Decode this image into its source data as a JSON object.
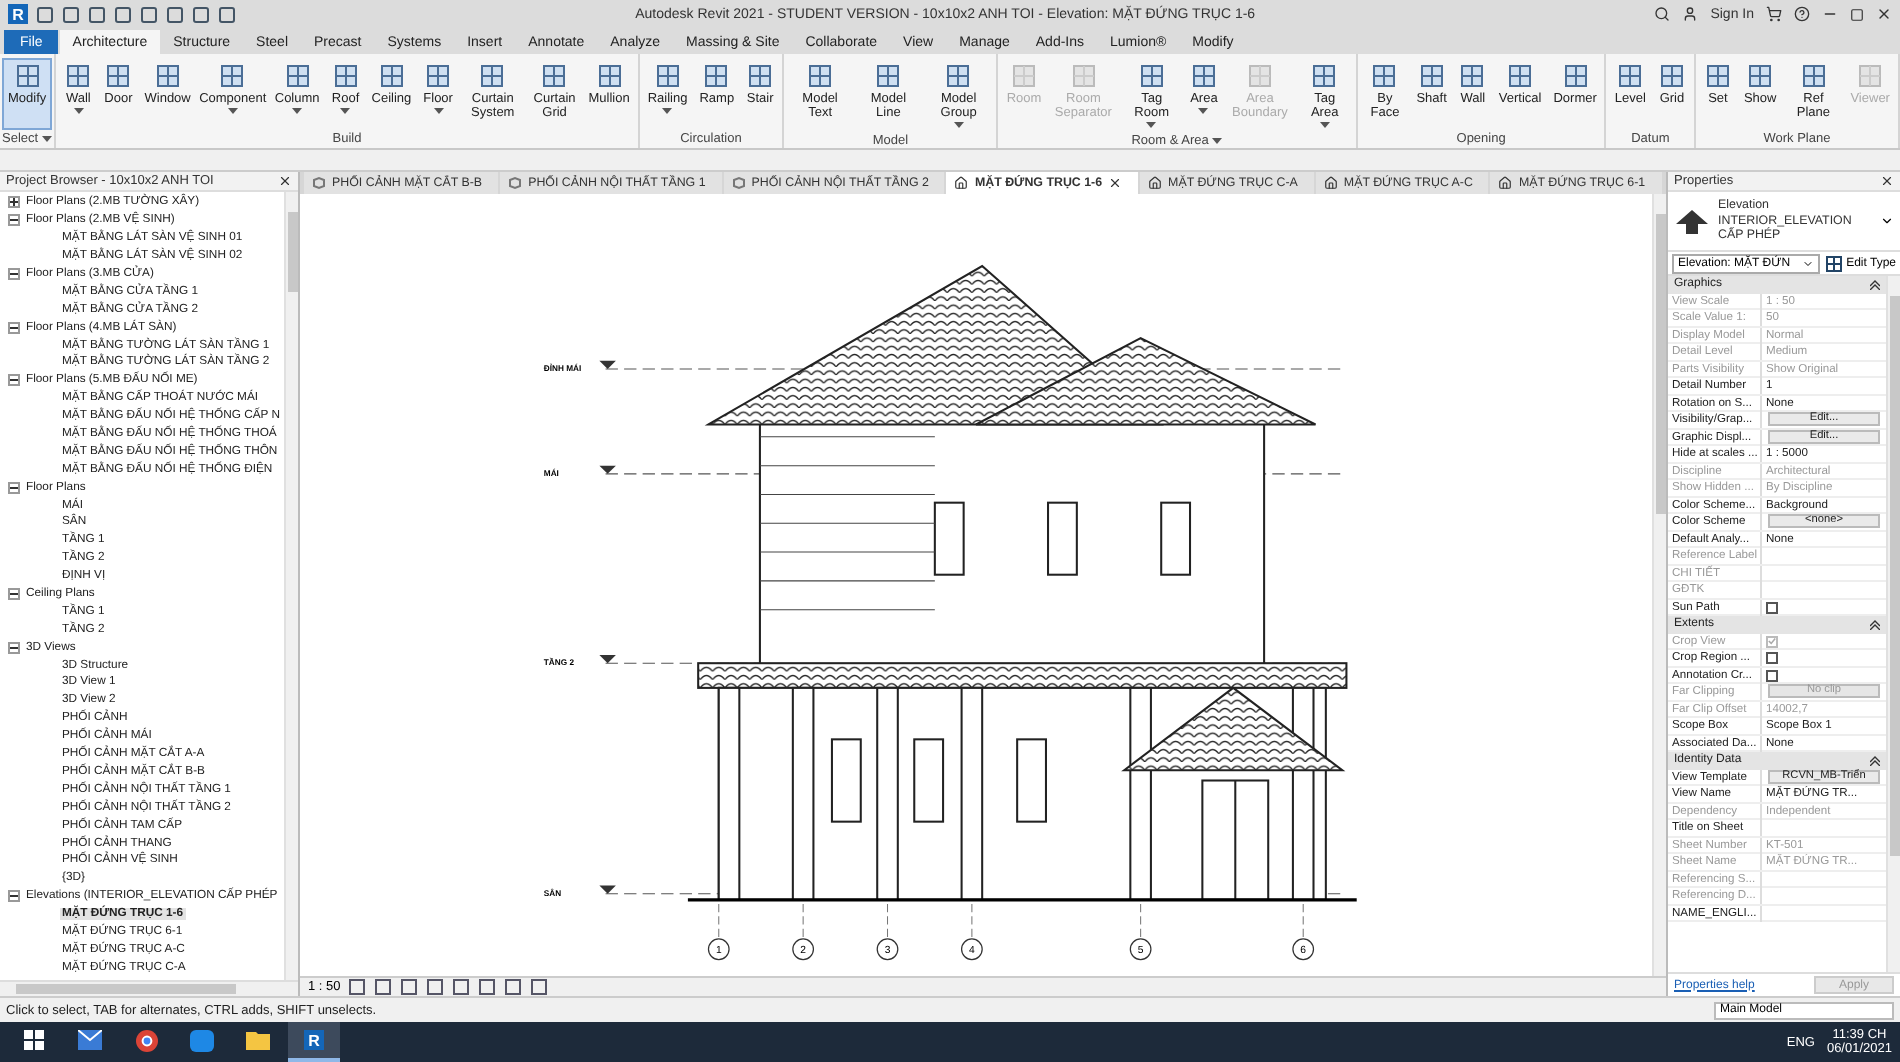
{
  "title_bar": {
    "logo_letter": "R",
    "title": "Autodesk Revit 2021 - STUDENT VERSION - 10x10x2 ANH TOI - Elevation: MẶT ĐỨNG TRỤC 1-6",
    "sign_in": "Sign In"
  },
  "file_tab": {
    "label": "File"
  },
  "ribbon_tabs": [
    {
      "label": "Architecture",
      "selected": true
    },
    {
      "label": "Structure",
      "selected": false
    },
    {
      "label": "Steel",
      "selected": false
    },
    {
      "label": "Precast",
      "selected": false
    },
    {
      "label": "Systems",
      "selected": false
    },
    {
      "label": "Insert",
      "selected": false
    },
    {
      "label": "Annotate",
      "selected": false
    },
    {
      "label": "Analyze",
      "selected": false
    },
    {
      "label": "Massing & Site",
      "selected": false
    },
    {
      "label": "Collaborate",
      "selected": false
    },
    {
      "label": "View",
      "selected": false
    },
    {
      "label": "Manage",
      "selected": false
    },
    {
      "label": "Add-Ins",
      "selected": false
    },
    {
      "label": "Lumion®",
      "selected": false
    },
    {
      "label": "Modify",
      "selected": false
    }
  ],
  "ribbon_panels": [
    {
      "label": "Select",
      "dropdown": true,
      "tools": [
        {
          "label": "Modify",
          "selected": true,
          "disabled": false
        }
      ]
    },
    {
      "label": "Build",
      "tools": [
        {
          "label": "Wall",
          "dropdown": true,
          "disabled": false
        },
        {
          "label": "Door",
          "disabled": false
        },
        {
          "label": "Window",
          "disabled": false
        },
        {
          "label": "Component",
          "dropdown": true,
          "disabled": false
        },
        {
          "label": "Column",
          "dropdown": true,
          "disabled": false
        },
        {
          "label": "Roof",
          "dropdown": true,
          "disabled": false
        },
        {
          "label": "Ceiling",
          "disabled": false
        },
        {
          "label": "Floor",
          "dropdown": true,
          "disabled": false
        },
        {
          "label": "Curtain System",
          "disabled": false
        },
        {
          "label": "Curtain Grid",
          "disabled": false
        },
        {
          "label": "Mullion",
          "disabled": false
        }
      ]
    },
    {
      "label": "Circulation",
      "tools": [
        {
          "label": "Railing",
          "dropdown": true,
          "disabled": false
        },
        {
          "label": "Ramp",
          "disabled": false
        },
        {
          "label": "Stair",
          "disabled": false
        }
      ]
    },
    {
      "label": "Model",
      "tools": [
        {
          "label": "Model Text",
          "disabled": false
        },
        {
          "label": "Model Line",
          "disabled": false
        },
        {
          "label": "Model Group",
          "dropdown": true,
          "disabled": false
        }
      ]
    },
    {
      "label": "Room & Area",
      "dropdown": true,
      "tools": [
        {
          "label": "Room",
          "disabled": true
        },
        {
          "label": "Room Separator",
          "disabled": true
        },
        {
          "label": "Tag Room",
          "dropdown": true,
          "disabled": false
        },
        {
          "label": "Area",
          "dropdown": true,
          "disabled": false
        },
        {
          "label": "Area Boundary",
          "disabled": true
        },
        {
          "label": "Tag Area",
          "dropdown": true,
          "disabled": false
        }
      ]
    },
    {
      "label": "Opening",
      "tools": [
        {
          "label": "By Face",
          "disabled": false
        },
        {
          "label": "Shaft",
          "disabled": false
        },
        {
          "label": "Wall",
          "disabled": false
        },
        {
          "label": "Vertical",
          "disabled": false
        },
        {
          "label": "Dormer",
          "disabled": false
        }
      ]
    },
    {
      "label": "Datum",
      "tools": [
        {
          "label": "Level",
          "disabled": false
        },
        {
          "label": "Grid",
          "disabled": false
        }
      ]
    },
    {
      "label": "Work Plane",
      "tools": [
        {
          "label": "Set",
          "disabled": false
        },
        {
          "label": "Show",
          "disabled": false
        },
        {
          "label": "Ref Plane",
          "disabled": false
        },
        {
          "label": "Viewer",
          "disabled": true
        }
      ]
    }
  ],
  "project_browser": {
    "title": "Project Browser - 10x10x2 ANH TOI",
    "tree": [
      {
        "label": "Floor Plans (2.MB TƯỜNG XÂY)",
        "expanded": false
      },
      {
        "label": "Floor Plans (2.MB VỆ SINH)",
        "expanded": true,
        "children": [
          {
            "label": "MẶT BẰNG LÁT SÀN VỆ SINH 01"
          },
          {
            "label": "MẶT BẰNG LÁT SÀN VỆ SINH 02"
          }
        ]
      },
      {
        "label": "Floor Plans (3.MB CỬA)",
        "expanded": true,
        "children": [
          {
            "label": "MẶT BẰNG CỬA TẦNG 1"
          },
          {
            "label": "MẶT BẰNG CỬA TẦNG 2"
          }
        ]
      },
      {
        "label": "Floor Plans (4.MB LÁT SÀN)",
        "expanded": true,
        "children": [
          {
            "label": "MẶT BẰNG TƯỜNG LÁT SÀN TẦNG 1"
          },
          {
            "label": "MẶT BẰNG TƯỜNG LÁT SÀN TẦNG 2"
          }
        ]
      },
      {
        "label": "Floor Plans (5.MB ĐẤU NỐI ME)",
        "expanded": true,
        "children": [
          {
            "label": "MẶT BẰNG CẤP THOÁT NƯỚC MÁI"
          },
          {
            "label": "MẶT BẰNG ĐẤU NỐI HỆ THỐNG CẤP N"
          },
          {
            "label": "MẶT BẰNG ĐẤU NỐI HỆ THỐNG THOÁ"
          },
          {
            "label": "MẶT BẰNG ĐẤU NỐI HỆ THỐNG THÔN"
          },
          {
            "label": "MẶT BẰNG ĐẤU NỐI HỆ THỐNG ĐIỆN"
          }
        ]
      },
      {
        "label": "Floor Plans",
        "expanded": true,
        "children": [
          {
            "label": "MÁI"
          },
          {
            "label": "SÂN"
          },
          {
            "label": "TẦNG 1"
          },
          {
            "label": "TẦNG 2"
          },
          {
            "label": "ĐỊNH VỊ"
          }
        ]
      },
      {
        "label": "Ceiling Plans",
        "expanded": true,
        "children": [
          {
            "label": "TẦNG 1"
          },
          {
            "label": "TẦNG 2"
          }
        ]
      },
      {
        "label": "3D Views",
        "expanded": true,
        "children": [
          {
            "label": "3D Structure"
          },
          {
            "label": "3D View 1"
          },
          {
            "label": "3D View 2"
          },
          {
            "label": "PHỐI CẢNH"
          },
          {
            "label": "PHỐI CẢNH MÁI"
          },
          {
            "label": "PHỐI CẢNH MẶT CẮT A-A"
          },
          {
            "label": "PHỐI CẢNH MẶT CẮT B-B"
          },
          {
            "label": "PHỐI CẢNH NỘI THẤT TẦNG 1"
          },
          {
            "label": "PHỐI CẢNH NỘI THẤT TẦNG 2"
          },
          {
            "label": "PHỐI CẢNH TAM CẤP"
          },
          {
            "label": "PHỐI CẢNH THANG"
          },
          {
            "label": "PHỐI CẢNH VỆ SINH"
          },
          {
            "label": "{3D}"
          }
        ]
      },
      {
        "label": "Elevations (INTERIOR_ELEVATION CẤP PHÉP",
        "expanded": true,
        "children": [
          {
            "label": "MẶT ĐỨNG TRỤC 1-6",
            "selected": true
          },
          {
            "label": "MẶT ĐỨNG TRỤC 6-1",
            "selected": false
          },
          {
            "label": "MẶT ĐỨNG TRỤC A-C",
            "selected": false
          },
          {
            "label": "MẶT ĐỨNG TRỤC C-A",
            "selected": false
          }
        ]
      }
    ]
  },
  "view_tabs": [
    {
      "label": "PHỐI CẢNH MẶT CẮT B-B",
      "kind": "perspective",
      "selected": false
    },
    {
      "label": "PHỐI CẢNH NỘI THẤT TẦNG 1",
      "kind": "perspective",
      "selected": false
    },
    {
      "label": "PHỐI CẢNH NỘI THẤT TẦNG 2",
      "kind": "perspective",
      "selected": false
    },
    {
      "label": "MẶT ĐỨNG TRỤC 1-6",
      "kind": "elevation",
      "selected": true
    },
    {
      "label": "MẶT ĐỨNG TRỤC C-A",
      "kind": "elevation",
      "selected": false
    },
    {
      "label": "MẶT ĐỨNG TRỤC A-C",
      "kind": "elevation",
      "selected": false
    },
    {
      "label": "MẶT ĐỨNG TRỤC 6-1",
      "kind": "elevation",
      "selected": false
    }
  ],
  "elevation": {
    "levels": [
      {
        "name": "ĐỈNH MÁI"
      },
      {
        "name": "MÁI"
      },
      {
        "name": "TẦNG 2"
      },
      {
        "name": "SÂN"
      }
    ],
    "grids": [
      "1",
      "2",
      "3",
      "4",
      "5",
      "6"
    ],
    "scale": "1 : 50"
  },
  "properties": {
    "title": "Properties",
    "family": "Elevation",
    "type": "INTERIOR_ELEVATION CẤP PHÉP",
    "instance": "Elevation: MẶT ĐỨN",
    "edit_type": "Edit Type",
    "sections": [
      {
        "label": "Graphics",
        "rows": [
          {
            "label": "View Scale",
            "kind": "text",
            "value": "1 : 50",
            "disabled": true
          },
          {
            "label": "Scale Value    1:",
            "kind": "text",
            "value": "50",
            "disabled": true
          },
          {
            "label": "Display Model",
            "kind": "text",
            "value": "Normal",
            "disabled": true
          },
          {
            "label": "Detail Level",
            "kind": "text",
            "value": "Medium",
            "disabled": true
          },
          {
            "label": "Parts Visibility",
            "kind": "text",
            "value": "Show Original",
            "disabled": true
          },
          {
            "label": "Detail Number",
            "kind": "text",
            "value": "1",
            "disabled": false
          },
          {
            "label": "Rotation on S...",
            "kind": "text",
            "value": "None",
            "disabled": false
          },
          {
            "label": "Visibility/Grap...",
            "kind": "button",
            "value": "Edit...",
            "disabled": false
          },
          {
            "label": "Graphic Displ...",
            "kind": "button",
            "value": "Edit...",
            "disabled": false
          },
          {
            "label": "Hide at scales ...",
            "kind": "text",
            "value": "1 : 5000",
            "disabled": false
          },
          {
            "label": "Discipline",
            "kind": "text",
            "value": "Architectural",
            "disabled": true
          },
          {
            "label": "Show Hidden ...",
            "kind": "text",
            "value": "By Discipline",
            "disabled": true
          },
          {
            "label": "Color Scheme...",
            "kind": "text",
            "value": "Background",
            "disabled": false
          },
          {
            "label": "Color Scheme",
            "kind": "button",
            "value": "<none>",
            "disabled": false
          },
          {
            "label": "Default Analy...",
            "kind": "text",
            "value": "None",
            "disabled": false
          },
          {
            "label": "Reference Label",
            "kind": "text",
            "disabled": true
          },
          {
            "label": "CHI TIẾT",
            "kind": "text",
            "disabled": true
          },
          {
            "label": "GĐTK",
            "kind": "text",
            "disabled": true
          },
          {
            "label": "Sun Path",
            "kind": "checkbox",
            "checked": false,
            "disabled": false
          }
        ]
      },
      {
        "label": "Extents",
        "rows": [
          {
            "label": "Crop View",
            "kind": "checkbox",
            "checked": true,
            "disabled": true
          },
          {
            "label": "Crop Region ...",
            "kind": "checkbox",
            "checked": false,
            "disabled": false
          },
          {
            "label": "Annotation Cr...",
            "kind": "checkbox",
            "checked": false,
            "disabled": false
          },
          {
            "label": "Far Clipping",
            "kind": "button",
            "value": "No clip",
            "disabled": true
          },
          {
            "label": "Far Clip Offset",
            "kind": "text",
            "value": "14002,7",
            "disabled": true
          },
          {
            "label": "Scope Box",
            "kind": "text",
            "value": "Scope Box 1",
            "disabled": false
          },
          {
            "label": "Associated Da...",
            "kind": "text",
            "value": "None",
            "disabled": false
          }
        ]
      },
      {
        "label": "Identity Data",
        "rows": [
          {
            "label": "View Template",
            "kind": "button",
            "value": "RCVN_MB-Triển",
            "disabled": false
          },
          {
            "label": "View Name",
            "kind": "text",
            "value": "MẶT ĐỨNG TR...",
            "disabled": false
          },
          {
            "label": "Dependency",
            "kind": "text",
            "value": "Independent",
            "disabled": true
          },
          {
            "label": "Title on Sheet",
            "kind": "text",
            "disabled": false
          },
          {
            "label": "Sheet Number",
            "kind": "text",
            "value": "KT-501",
            "disabled": true
          },
          {
            "label": "Sheet Name",
            "kind": "text",
            "value": "MẶT ĐỨNG TR...",
            "disabled": true
          },
          {
            "label": "Referencing S...",
            "kind": "text",
            "disabled": true
          },
          {
            "label": "Referencing D...",
            "kind": "text",
            "disabled": true
          },
          {
            "label": "NAME_ENGLI...",
            "kind": "text",
            "disabled": false
          }
        ]
      }
    ],
    "help": "Properties help",
    "apply": "Apply"
  },
  "status_bar": {
    "message": "Click to select, TAB for alternates, CTRL adds, SHIFT unselects.",
    "model": "Main Model"
  },
  "taskbar": {
    "apps": [
      {
        "kind": "start"
      },
      {
        "kind": "mail"
      },
      {
        "kind": "browser"
      },
      {
        "kind": "chat",
        "selected": false
      },
      {
        "kind": "folder"
      },
      {
        "kind": "revit",
        "label": "R",
        "selected": true
      }
    ],
    "language": "ENG",
    "time": "11:39 CH",
    "date": "06/01/2021"
  }
}
